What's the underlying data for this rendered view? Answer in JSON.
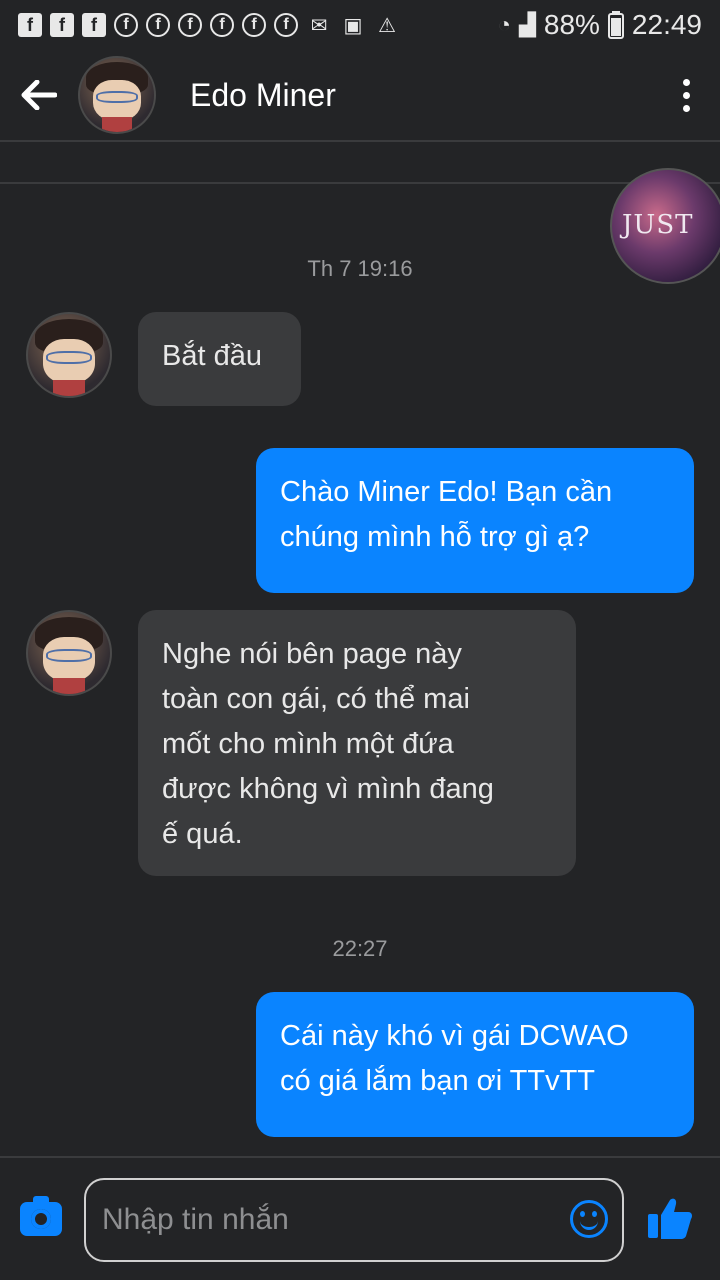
{
  "status_bar": {
    "left_icons": [
      "facebook-square-icon",
      "facebook-square-icon",
      "facebook-square-icon",
      "facebook-circle-icon",
      "facebook-circle-icon",
      "facebook-circle-icon",
      "facebook-circle-icon",
      "facebook-circle-icon",
      "facebook-circle-icon",
      "email-icon",
      "image-icon",
      "warning-icon"
    ],
    "battery": "88%",
    "time": "22:49"
  },
  "header": {
    "contact_name": "Edo Miner"
  },
  "messages": [
    {
      "type": "timestamp",
      "text": "Th 7 19:16"
    },
    {
      "type": "incoming",
      "text": "Bắt đầu"
    },
    {
      "type": "outgoing",
      "lines": [
        "Chào Miner Edo! Bạn cần",
        "chúng mình hỗ trợ gì ạ?"
      ]
    },
    {
      "type": "incoming",
      "lines": [
        "Nghe nói bên page này",
        "toàn con gái, có thể mai",
        "mốt cho mình một đứa",
        "được không vì mình đang",
        "ế quá."
      ]
    },
    {
      "type": "timestamp",
      "text": "22:27"
    },
    {
      "type": "outgoing",
      "lines": [
        "Cái này khó vì gái DCWAO",
        "có giá lắm bạn ơi TTvTT"
      ]
    }
  ],
  "seen_avatar_text": "JUST",
  "composer": {
    "placeholder": "Nhập tin nhắn"
  },
  "colors": {
    "background": "#232426",
    "incoming_bubble": "#3a3b3d",
    "outgoing_bubble": "#0a84ff",
    "accent": "#0a84ff"
  }
}
